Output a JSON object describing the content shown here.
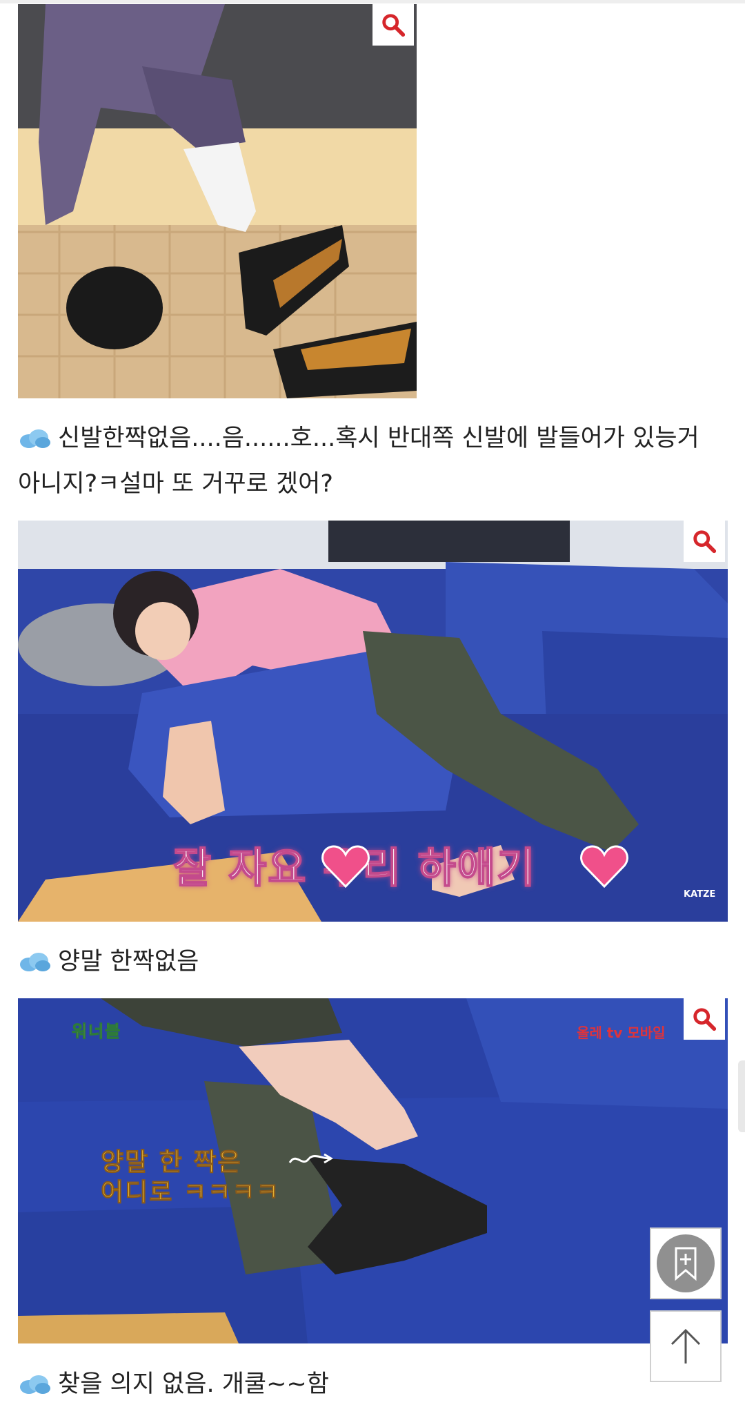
{
  "captions": {
    "c1_line1": "신발한짝없음....음......호...혹시 반대쪽 신발에 발들어가 있능거",
    "c1_line2": "아니지?ㅋ설마 또 거꾸로 겠어?",
    "c2": "양말 한짝없음",
    "c3": "찾을 의지 없음. 개쿨~~함"
  },
  "image2": {
    "overlay_text": "잘 자요 우리 하애기",
    "watermark": "KATZE"
  },
  "image3": {
    "logo_text": "워너블",
    "channel_text": "올레 tv 모바일",
    "overlay_line1": "양말 한 짝은",
    "overlay_line2": "어디로 ㅋㅋㅋㅋ"
  },
  "icons": {
    "zoom": "magnifier-icon",
    "bullet": "cloud-icon",
    "bookmark": "bookmark-add-icon",
    "top": "arrow-up-icon"
  },
  "colors": {
    "zoom_icon": "#d6262b",
    "sofa_blue": "#2a3f9a",
    "heart_pink": "#f0508a"
  }
}
